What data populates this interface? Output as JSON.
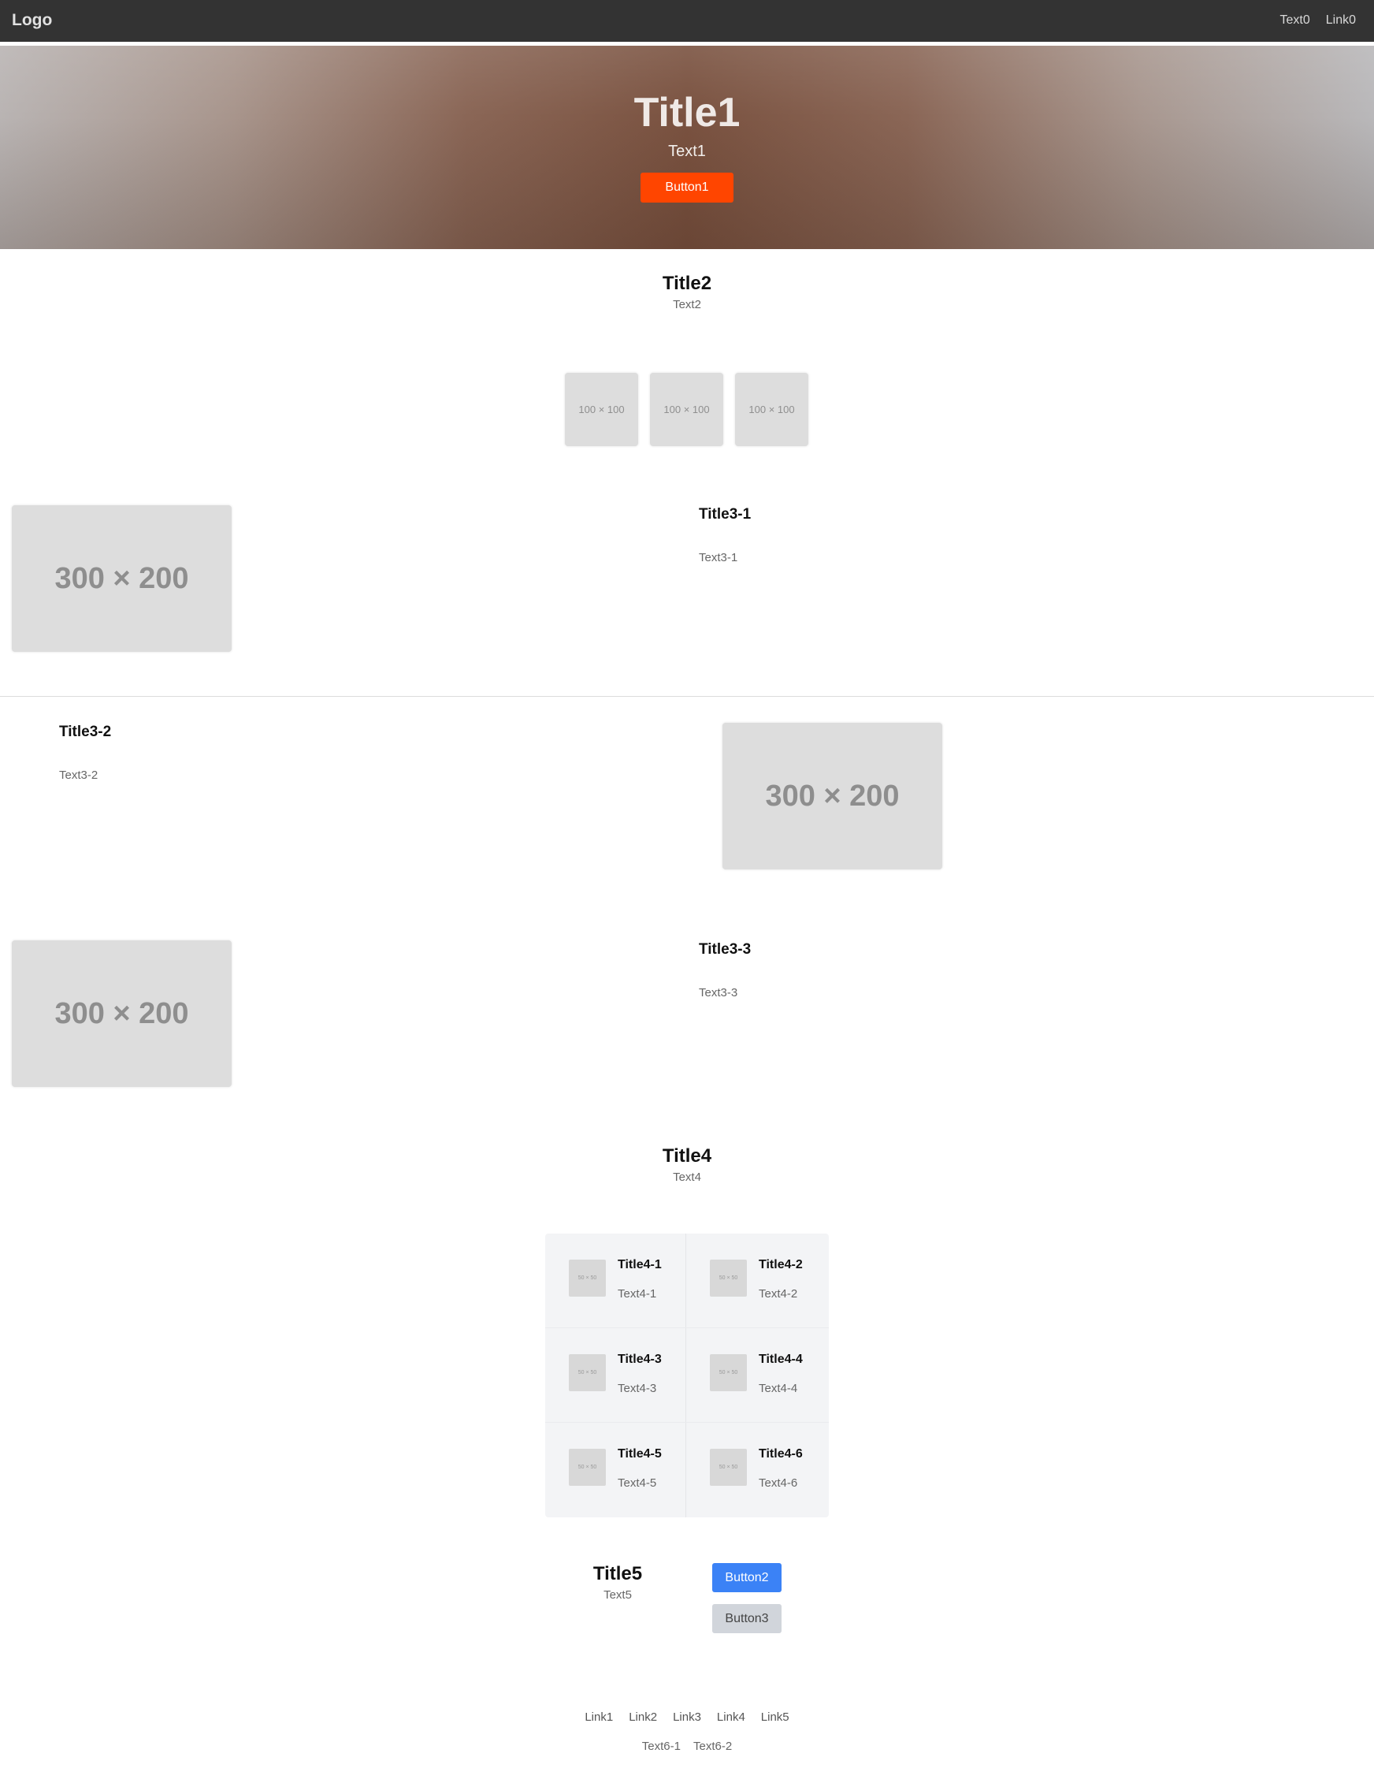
{
  "nav": {
    "logo": "Logo",
    "text": "Text0",
    "link": "Link0"
  },
  "hero": {
    "title": "Title1",
    "text": "Text1",
    "button": "Button1"
  },
  "section2": {
    "title": "Title2",
    "text": "Text2",
    "thumbs": [
      "100 × 100",
      "100 × 100",
      "100 × 100"
    ]
  },
  "features": [
    {
      "title": "Title3-1",
      "text": "Text3-1",
      "image": "300 × 200"
    },
    {
      "title": "Title3-2",
      "text": "Text3-2",
      "image": "300 × 200"
    },
    {
      "title": "Title3-3",
      "text": "Text3-3",
      "image": "300 × 200"
    }
  ],
  "section4": {
    "title": "Title4",
    "text": "Text4",
    "items": [
      {
        "title": "Title4-1",
        "text": "Text4-1",
        "image": "50 × 50"
      },
      {
        "title": "Title4-2",
        "text": "Text4-2",
        "image": "50 × 50"
      },
      {
        "title": "Title4-3",
        "text": "Text4-3",
        "image": "50 × 50"
      },
      {
        "title": "Title4-4",
        "text": "Text4-4",
        "image": "50 × 50"
      },
      {
        "title": "Title4-5",
        "text": "Text4-5",
        "image": "50 × 50"
      },
      {
        "title": "Title4-6",
        "text": "Text4-6",
        "image": "50 × 50"
      }
    ]
  },
  "section5": {
    "title": "Title5",
    "text": "Text5",
    "button_primary": "Button2",
    "button_secondary": "Button3"
  },
  "footer": {
    "links": [
      "Link1",
      "Link2",
      "Link3",
      "Link4",
      "Link5"
    ],
    "texts": [
      "Text6-1",
      "Text6-2"
    ]
  },
  "colors": {
    "nav_bg": "#333333",
    "hero_button": "#ff4500",
    "primary_button": "#3b82f6",
    "secondary_button": "#d1d5db"
  }
}
